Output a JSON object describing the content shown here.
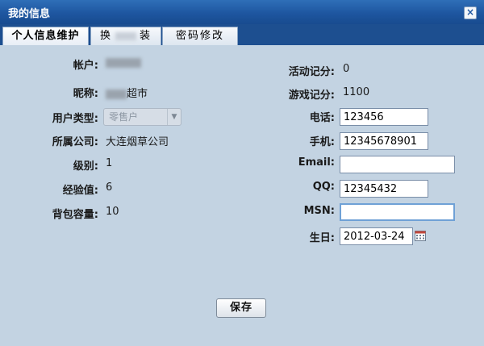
{
  "window": {
    "title": "我的信息",
    "close_glyph": "×"
  },
  "tabs": [
    {
      "label": "个人信息维护",
      "active": true
    },
    {
      "label_left": "换",
      "label_right": "装",
      "active": false
    },
    {
      "label": "密码修改",
      "active": false
    }
  ],
  "left": {
    "account_label": "帐户:",
    "nickname_label": "昵称:",
    "nickname_suffix": "超市",
    "usertype_label": "用户类型:",
    "usertype_value": "零售户",
    "company_label": "所属公司:",
    "company_value": "大连烟草公司",
    "level_label": "级别:",
    "level_value": "1",
    "exp_label": "经验值:",
    "exp_value": "6",
    "bag_label": "背包容量:",
    "bag_value": "10"
  },
  "right": {
    "activity_label": "活动记分:",
    "activity_value": "0",
    "game_label": "游戏记分:",
    "game_value": "1100",
    "phone_label": "电话:",
    "phone_value": "123456",
    "mobile_label": "手机:",
    "mobile_value": "12345678901",
    "email_label": "Email:",
    "email_value": "",
    "qq_label": "QQ:",
    "qq_value": "12345432",
    "msn_label": "MSN:",
    "msn_value": "",
    "birthday_label": "生日:",
    "birthday_value": "2012-03-24"
  },
  "icons": {
    "calendar": "calendar-icon",
    "close": "close-icon",
    "dropdown": "chevron-down-icon"
  },
  "actions": {
    "save_label": "保存"
  },
  "colors": {
    "titlebar": "#1e56a0",
    "tabbar": "#1d4f90",
    "background": "#c3d3e2"
  }
}
